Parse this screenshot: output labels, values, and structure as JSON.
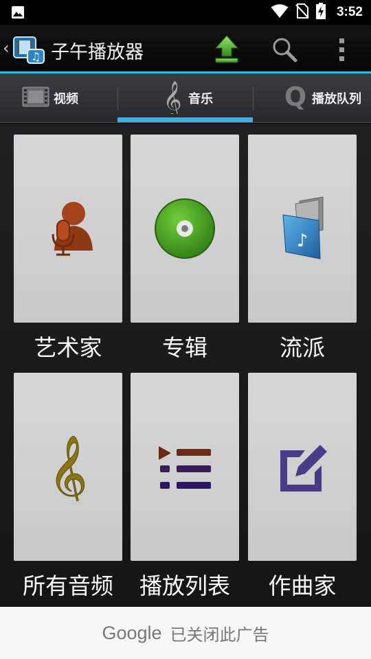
{
  "status_bar": {
    "time": "3:52"
  },
  "app_bar": {
    "title": "子午播放器",
    "actions": [
      "upload-icon",
      "search-icon",
      "overflow-menu-icon"
    ]
  },
  "tabs": [
    {
      "label": "视频",
      "icon": "film-strip-icon",
      "selected": false
    },
    {
      "label": "音乐",
      "icon": "treble-clef-icon",
      "selected": true
    },
    {
      "label": "播放队列",
      "icon": "queue-q-icon",
      "selected": false
    }
  ],
  "grid": [
    {
      "label": "艺术家",
      "icon": "artist-microphone-icon"
    },
    {
      "label": "专辑",
      "icon": "album-disc-icon"
    },
    {
      "label": "流派",
      "icon": "genre-folder-icon"
    },
    {
      "label": "所有音频",
      "icon": "treble-clef-icon"
    },
    {
      "label": "播放列表",
      "icon": "playlist-icon"
    },
    {
      "label": "作曲家",
      "icon": "composer-edit-icon"
    }
  ],
  "ad_bar": {
    "brand": "Google",
    "text": "已关闭此广告"
  },
  "colors": {
    "accent": "#33b5e5",
    "tile": "#d0d0d0",
    "background": "#1a1c1e"
  }
}
